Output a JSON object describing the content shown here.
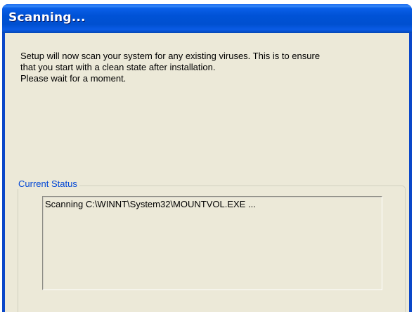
{
  "window": {
    "title": "Scanning..."
  },
  "message": {
    "lines": [
      "Setup will now scan your system for any existing viruses. This is to ensure",
      "that you start with a clean state after installation.",
      "Please wait for a moment."
    ]
  },
  "status_group": {
    "label": "Current Status",
    "text": "Scanning C:\\WINNT\\System32\\MOUNTVOL.EXE ..."
  },
  "colors": {
    "titlebar": "#0054e3",
    "dialog_background": "#ece9d8",
    "group_label": "#0046d5"
  }
}
